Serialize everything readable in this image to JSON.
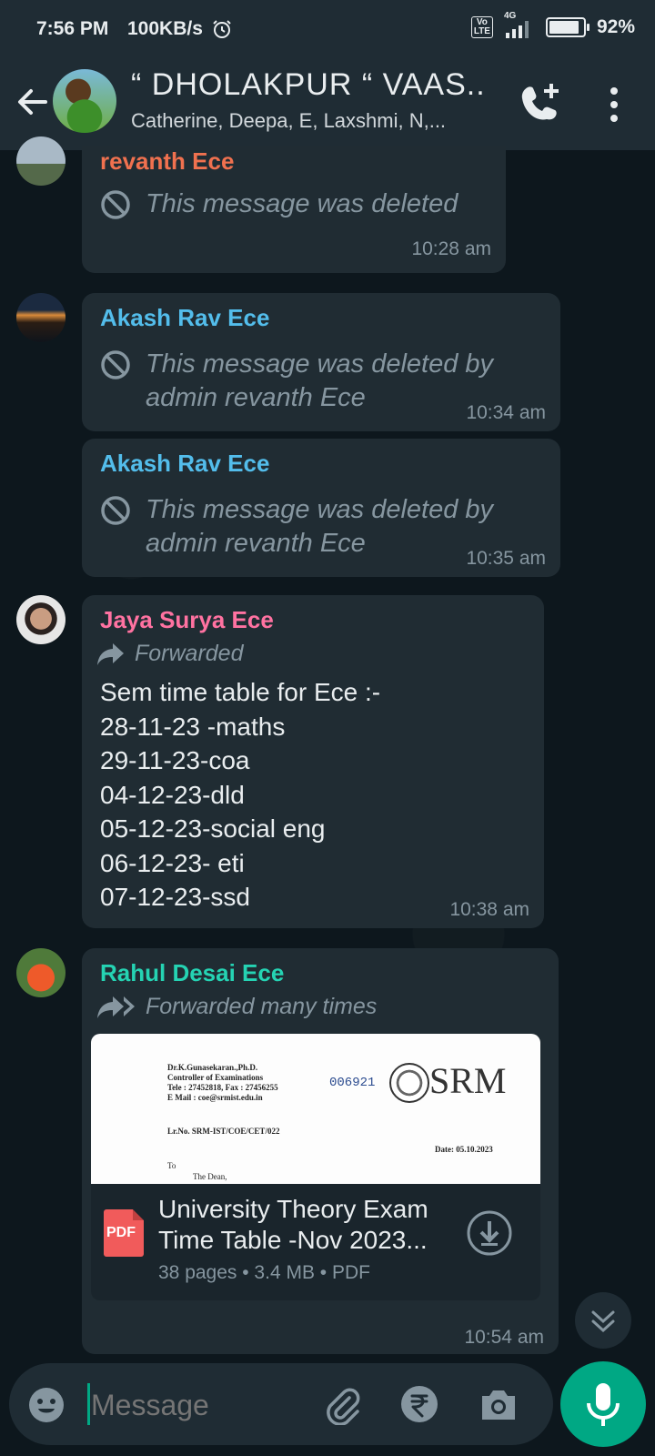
{
  "status_bar": {
    "time": "7:56 PM",
    "speed": "100KB/s",
    "network": "4G",
    "volte": "Vo LTE",
    "battery": "92%",
    "battery_level": 0.92
  },
  "header": {
    "title": "“ DHOLAKPUR “ VAAS...",
    "participants": "Catherine, Deepa, E, Laxshmi, N,..."
  },
  "messages": [
    {
      "sender": "revanth Ece",
      "sender_color": "#f0714f",
      "text": "This message was deleted",
      "time": "10:28 am"
    },
    {
      "sender": "Akash Rav Ece",
      "sender_color": "#53bdeb",
      "line1": "This message was deleted by",
      "line2": "admin revanth Ece",
      "time": "10:34 am"
    },
    {
      "sender": "Akash Rav Ece",
      "sender_color": "#53bdeb",
      "line1": "This message was deleted by",
      "line2": "admin revanth Ece",
      "time": "10:35 am"
    },
    {
      "sender": "Jaya Surya Ece",
      "sender_color": "#ff72a1",
      "forwarded": "Forwarded",
      "text": "Sem time table for Ece :-\n28-11-23 -maths\n29-11-23-coa\n04-12-23-dld\n05-12-23-social eng\n06-12-23- eti\n07-12-23-ssd",
      "time": "10:38 am"
    },
    {
      "sender": "Rahul Desai Ece",
      "sender_color": "#25d3b3",
      "forwarded": "Forwarded many times",
      "doc_preview": {
        "name_line": "Dr.K.Gunasekaran.,Ph.D.",
        "role_line": "Controller of Examinations",
        "phone_line": "Tele : 27452818, Fax : 27456255",
        "mail_line": "E Mail : coe@srmist.edu.in",
        "ref_number": "006921",
        "logo": "SRM",
        "letter_no": "Lr.No. SRM-IST/COE/CET/022",
        "date": "Date: 05.10.2023",
        "to": "To",
        "dean": "The Dean,"
      },
      "doc_title_line1": "University Theory Exam",
      "doc_title_line2": "Time Table -Nov 2023...",
      "doc_meta": "38 pages • 3.4 MB • PDF",
      "doc_badge": "PDF",
      "time": "10:54 am"
    }
  ],
  "input": {
    "placeholder": "Message"
  }
}
